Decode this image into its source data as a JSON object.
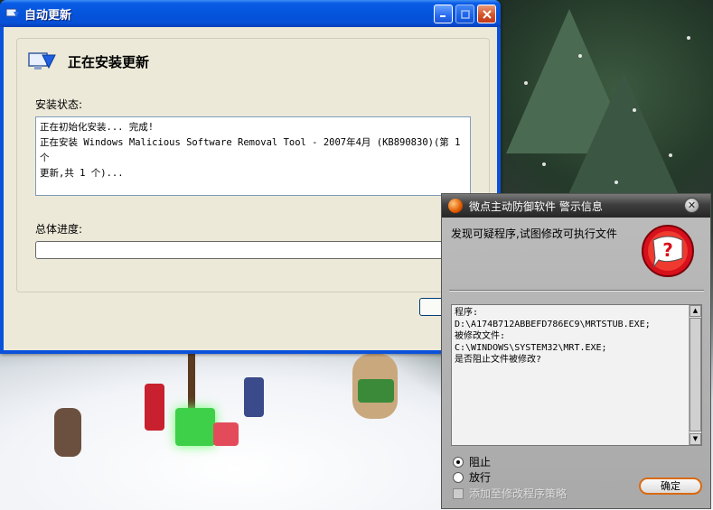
{
  "update_window": {
    "title": "自动更新",
    "heading": "正在安装更新",
    "status_label": "安装状态:",
    "status_log": "正在初始化安装... 完成!\n正在安装 Windows Malicious Software Removal Tool - 2007年4月 (KB890830)(第 1 个\n更新,共 1 个)...",
    "progress_label": "总体进度:",
    "progress_fraction": 0
  },
  "alert_popup": {
    "title": "微点主动防御软件   警示信息",
    "message": "发现可疑程序,试图修改可执行文件",
    "details": "程序:\nD:\\A174B712ABBEFD786EC9\\MRTSTUB.EXE;\n被修改文件:\nC:\\WINDOWS\\SYSTEM32\\MRT.EXE;\n是否阻止文件被修改?",
    "options": {
      "block": "阻止",
      "allow": "放行",
      "add_rule": "添加至修改程序策略"
    },
    "selected_option": "block",
    "ok_label": "确定",
    "accent_color": "#d96a10"
  },
  "colors": {
    "xp_title_blue": "#0454dc",
    "window_face": "#ece9d8",
    "popup_gray": "#b3b3b3"
  }
}
